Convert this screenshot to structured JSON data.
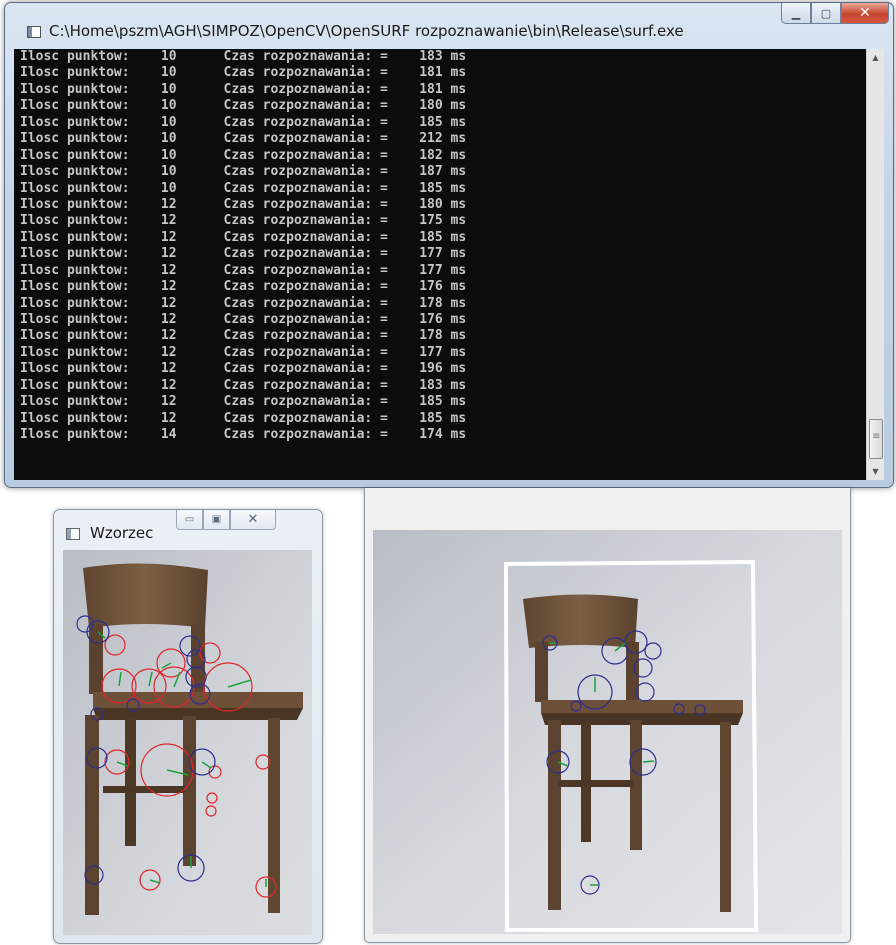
{
  "console_window": {
    "title": "C:\\Home\\pszm\\AGH\\SIMPOZ\\OpenCV\\OpenSURF rozpoznawanie\\bin\\Release\\surf.exe",
    "icon": "console-app-icon",
    "buttons": {
      "minimize": "minimize-icon",
      "maximize": "maximize-icon",
      "close": "close-icon"
    },
    "line_template": {
      "label": "Ilosc punktow:",
      "time_label": "Czas rozpoznawania: =",
      "unit": "ms"
    },
    "lines": [
      {
        "points": "10",
        "time": "183"
      },
      {
        "points": "10",
        "time": "181"
      },
      {
        "points": "10",
        "time": "181"
      },
      {
        "points": "10",
        "time": "180"
      },
      {
        "points": "10",
        "time": "185"
      },
      {
        "points": "10",
        "time": "212"
      },
      {
        "points": "10",
        "time": "182"
      },
      {
        "points": "10",
        "time": "187"
      },
      {
        "points": "10",
        "time": "185"
      },
      {
        "points": "12",
        "time": "180"
      },
      {
        "points": "12",
        "time": "175"
      },
      {
        "points": "12",
        "time": "185"
      },
      {
        "points": "12",
        "time": "177"
      },
      {
        "points": "12",
        "time": "177"
      },
      {
        "points": "12",
        "time": "176"
      },
      {
        "points": "12",
        "time": "178"
      },
      {
        "points": "12",
        "time": "176"
      },
      {
        "points": "12",
        "time": "178"
      },
      {
        "points": "12",
        "time": "177"
      },
      {
        "points": "12",
        "time": "196"
      },
      {
        "points": "12",
        "time": "183"
      },
      {
        "points": "12",
        "time": "185"
      },
      {
        "points": "12",
        "time": "185"
      },
      {
        "points": "14",
        "time": "174"
      }
    ],
    "colors": {
      "background": "#0c0c0c",
      "text": "#c6c6c6"
    }
  },
  "pattern_window": {
    "title": "Wzorzec",
    "icon": "window-app-icon",
    "buttons": {
      "minimize": "minimize-icon",
      "maximize": "maximize-icon",
      "close": "close-icon"
    },
    "image": "chair-photo-with-keypoints",
    "colors": {
      "keypoint_red": "#e0252a",
      "keypoint_blue": "#2d2f8f",
      "orientation_line": "#1aa33a"
    }
  },
  "result_window": {
    "image": "chair-photo-with-detection-box",
    "colors": {
      "detection_box": "#ffffff",
      "keypoint_blue": "#2d2f8f",
      "orientation_line": "#1aa33a"
    }
  }
}
